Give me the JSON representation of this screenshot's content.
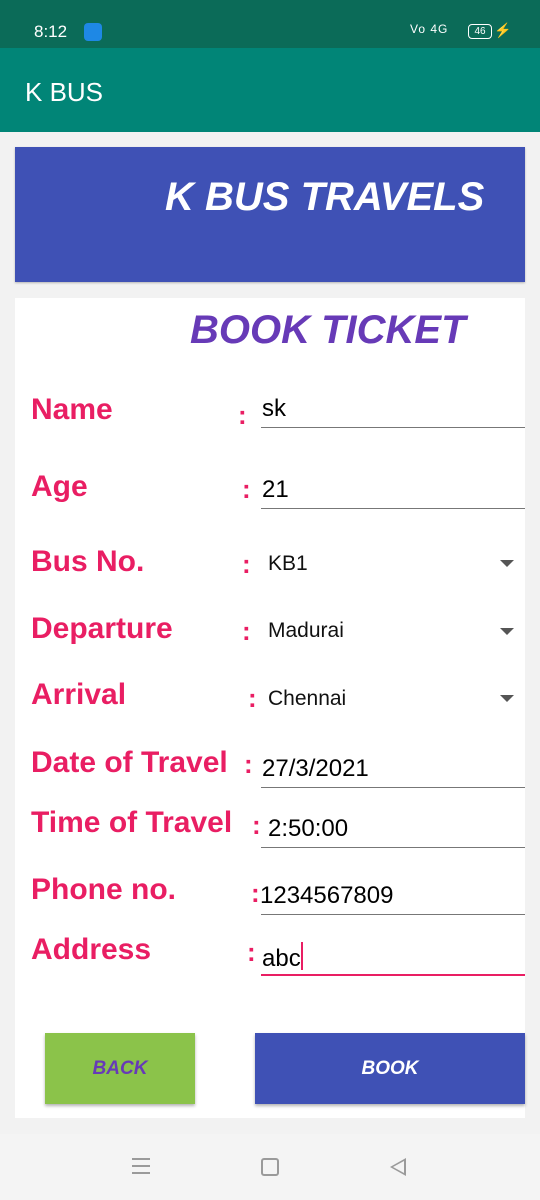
{
  "status_bar": {
    "time": "8:12",
    "signal_text": "Vo 4G",
    "battery": "46"
  },
  "app_bar": {
    "title": "K BUS"
  },
  "banner": {
    "title": "K BUS TRAVELS"
  },
  "form": {
    "title": "BOOK TICKET",
    "colon": ":",
    "fields": {
      "name": {
        "label": "Name",
        "value": "sk"
      },
      "age": {
        "label": "Age",
        "value": "21"
      },
      "bus_no": {
        "label": "Bus No.",
        "value": "KB1"
      },
      "departure": {
        "label": "Departure",
        "value": "Madurai"
      },
      "arrival": {
        "label": "Arrival",
        "value": "Chennai"
      },
      "date": {
        "label": "Date of Travel",
        "value": "27/3/2021"
      },
      "time": {
        "label": "Time of Travel",
        "value": "2:50:00"
      },
      "phone": {
        "label": "Phone no.",
        "value": "1234567809"
      },
      "address": {
        "label": "Address",
        "value": "abc"
      }
    }
  },
  "buttons": {
    "back": "BACK",
    "book": "BOOK"
  },
  "colors": {
    "primary": "#018577",
    "status_bar": "#0b6b58",
    "banner": "#3f51b5",
    "label": "#e91e63",
    "title": "#673ab7",
    "back_button": "#8bc34a"
  }
}
